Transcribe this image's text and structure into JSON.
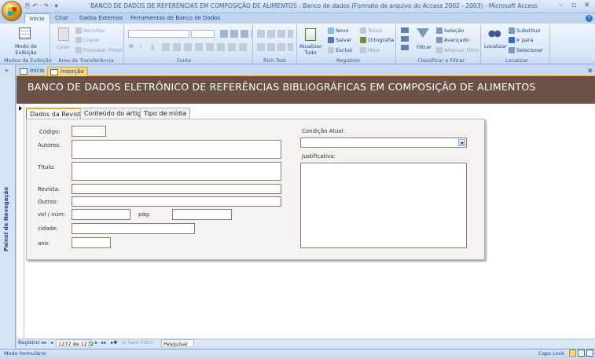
{
  "titlebar": {
    "title": "BANCO DE DADOS DE REFERÊNCIAS EM COMPOSIÇÃO DE ALIMENTOS : Banco de dados (Formato de arquivo do Access 2002 - 2003) - Microsoft Access",
    "qat": "⎘ ↶ · ↷ · ▾",
    "min": "–",
    "max": "▫",
    "close": "✕"
  },
  "ribbon_tabs": [
    "Início",
    "Criar",
    "Dados Externos",
    "Ferramentas de Banco de Dados"
  ],
  "ribbon": {
    "groups": {
      "modos": "Modos de Exibição",
      "area": "Área de Transferência",
      "fonte": "Fonte",
      "rich": "Rich Text",
      "registros": "Registros",
      "classificar": "Classificar e Filtrar",
      "localizar": "Localizar"
    },
    "modo_exibicao": "Modo de Exibição",
    "colar": "Colar",
    "recortar": "Recortar",
    "copiar": "Copiar",
    "formatar_pincel": "Formatar Pincel",
    "atualizar_tudo": "Atualizar Tudo",
    "novo": "Novo",
    "salvar": "Salvar",
    "excluir": "Excluir",
    "totais": "Totais",
    "ortografia": "Ortografia",
    "mais": "Mais",
    "filtrar": "Filtrar",
    "selecao": "Seleção",
    "avancado": "Avançado",
    "alternar_filtro": "Alternar Filtro",
    "localizar": "Localizar",
    "substituir": "Substituir",
    "ir_para": "Ir para",
    "selecionar": "Selecionar",
    "font_bold": "N",
    "font_italic": "I",
    "font_underline": "S"
  },
  "nav_pane": {
    "label": "Painel de Navegação",
    "toggle": "»"
  },
  "doc_tabs": [
    "Início",
    "Inserção"
  ],
  "form": {
    "header": "BANCO DE DADOS ELETRÔNICO DE REFERÊNCIAS BIBLIOGRÁFICAS EM COMPOSIÇÃO DE ALIMENTOS",
    "tabs": [
      "Dados da Revista",
      "Conteúdo do artigo",
      "Tipo de mídia"
    ],
    "labels": {
      "codigo": "Código:",
      "autores": "Autores:",
      "titulo": "Título:",
      "revista": "Revista:",
      "outros": "Outros:",
      "vol": "vol / núm:",
      "pag": "pág:",
      "cidade": "cidade:",
      "ano": "ano:",
      "condicao": "Condição Atual:",
      "justificativa": "Justificativa:"
    }
  },
  "record_nav": {
    "label": "Registro:",
    "first": "◂◂",
    "prev": "◂",
    "position": "1272 de 1272",
    "next": "▸",
    "last": "▸▸",
    "new": "▸✱",
    "filter": "Sem Filtro",
    "search": "Pesquisar"
  },
  "status": {
    "left": "Modo formulário",
    "caps": "Caps Lock"
  }
}
